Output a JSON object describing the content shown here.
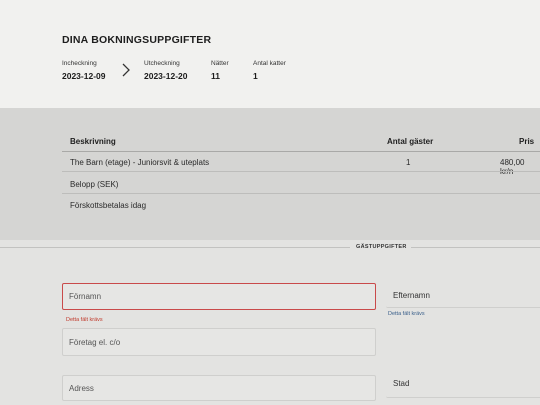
{
  "header": {
    "title": "DINA BOKNINGSUPPGIFTER",
    "checkin_label": "Incheckning",
    "checkin_value": "2023-12-09",
    "checkout_label": "Utcheckning",
    "checkout_value": "2023-12-20",
    "nights_label": "Nätter",
    "nights_value": "11",
    "cats_label": "Antal katter",
    "cats_value": "1"
  },
  "table": {
    "col_description": "Beskrivning",
    "col_guests": "Antal gäster",
    "col_price": "Pris",
    "rows": [
      {
        "description": "The Barn (etage) - Juniorsvit & uteplats",
        "guests": "1",
        "price": "480,00 kr/n"
      },
      {
        "description": "Belopp (SEK)"
      },
      {
        "description": "Förskottsbetalas idag"
      }
    ]
  },
  "guest": {
    "section_title": "GÄSTUPPGIFTER",
    "firstname_placeholder": "Förnamn",
    "firstname_error": "Detta fält krävs",
    "lastname_label": "Efternamn",
    "lastname_error": "Detta fält krävs",
    "company_placeholder": "Företag el. c/o",
    "address_placeholder": "Adress",
    "city_label": "Stad"
  }
}
